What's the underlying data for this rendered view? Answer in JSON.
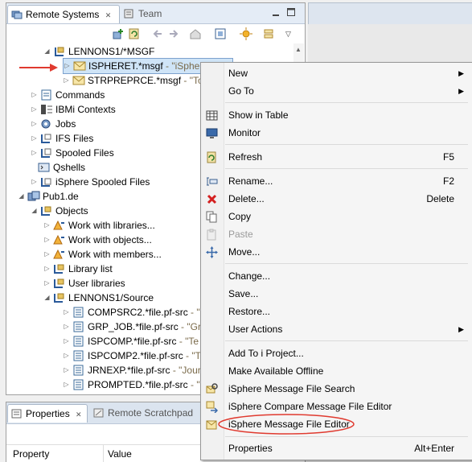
{
  "view": {
    "tabs": [
      {
        "label": "Remote Systems",
        "close": "✕"
      },
      {
        "label": "Team"
      }
    ]
  },
  "tree": {
    "rows": [
      {
        "label": "LENNONS1/*MSGF",
        "desc": ""
      },
      {
        "label": "ISPHERET.*msgf",
        "desc": " - \"iSphere Test\""
      },
      {
        "label": "STRPREPRCE.*msgf",
        "desc": " - \"Tools\""
      },
      {
        "label": "Commands",
        "desc": ""
      },
      {
        "label": "IBMi Contexts",
        "desc": ""
      },
      {
        "label": "Jobs",
        "desc": ""
      },
      {
        "label": "IFS Files",
        "desc": ""
      },
      {
        "label": "Spooled Files",
        "desc": ""
      },
      {
        "label": "Qshells",
        "desc": ""
      },
      {
        "label": "iSphere Spooled Files",
        "desc": ""
      },
      {
        "label": "Pub1.de",
        "desc": ""
      },
      {
        "label": "Objects",
        "desc": ""
      },
      {
        "label": "Work with libraries...",
        "desc": ""
      },
      {
        "label": "Work with objects...",
        "desc": ""
      },
      {
        "label": "Work with members...",
        "desc": ""
      },
      {
        "label": "Library list",
        "desc": ""
      },
      {
        "label": "User libraries",
        "desc": ""
      },
      {
        "label": "LENNONS1/Source",
        "desc": ""
      },
      {
        "label": "COMPSRC2.*file.pf-src",
        "desc": " - \"P"
      },
      {
        "label": "GRP_JOB.*file.pf-src",
        "desc": " - \"Gro"
      },
      {
        "label": "ISPCOMP.*file.pf-src",
        "desc": " - \"Te"
      },
      {
        "label": "ISPCOMP2.*file.pf-src",
        "desc": " - \"T"
      },
      {
        "label": "JRNEXP.*file.pf-src",
        "desc": " - \"Journ"
      },
      {
        "label": "PROMPTED.*file.pf-src",
        "desc": " - \"P"
      }
    ]
  },
  "properties": {
    "tabs": [
      {
        "label": "Properties",
        "close": "✕"
      },
      {
        "label": "Remote Scratchpad"
      }
    ],
    "columns": [
      "Property",
      "Value"
    ]
  },
  "menu": {
    "items": [
      {
        "label": "New",
        "shortcut": "",
        "submenu": true
      },
      {
        "label": "Go To",
        "shortcut": "",
        "submenu": true
      },
      {
        "label": "Show in Table",
        "shortcut": "",
        "icon": "table-icon"
      },
      {
        "label": "Monitor",
        "shortcut": "",
        "icon": "monitor-icon"
      },
      {
        "label": "Refresh",
        "shortcut": "F5",
        "icon": "refresh-icon"
      },
      {
        "label": "Rename...",
        "shortcut": "F2",
        "icon": "rename-icon"
      },
      {
        "label": "Delete...",
        "shortcut": "Delete",
        "icon": "delete-icon"
      },
      {
        "label": "Copy",
        "shortcut": "",
        "icon": "copy-icon"
      },
      {
        "label": "Paste",
        "shortcut": "",
        "icon": "paste-icon",
        "disabled": true
      },
      {
        "label": "Move...",
        "shortcut": "",
        "icon": "move-icon"
      },
      {
        "label": "Change...",
        "shortcut": ""
      },
      {
        "label": "Save...",
        "shortcut": ""
      },
      {
        "label": "Restore...",
        "shortcut": ""
      },
      {
        "label": "User Actions",
        "shortcut": "",
        "submenu": true
      },
      {
        "label": "Add To i Project...",
        "shortcut": ""
      },
      {
        "label": "Make Available Offline",
        "shortcut": ""
      },
      {
        "label": "iSphere Message File Search",
        "shortcut": "",
        "icon": "search-msgf-icon"
      },
      {
        "label": "iSphere Compare Message File Editor",
        "shortcut": "",
        "icon": "compare-icon"
      },
      {
        "label": "iSphere Message File Editor",
        "shortcut": "",
        "icon": "msgf-editor-icon",
        "highlighted": true
      },
      {
        "label": "Properties",
        "shortcut": "Alt+Enter"
      }
    ],
    "submenu_glyph": "▶"
  },
  "colors": {
    "annotation_red": "#e03a2f",
    "selection": "#cfe4f7",
    "folder": "#e8c460"
  }
}
